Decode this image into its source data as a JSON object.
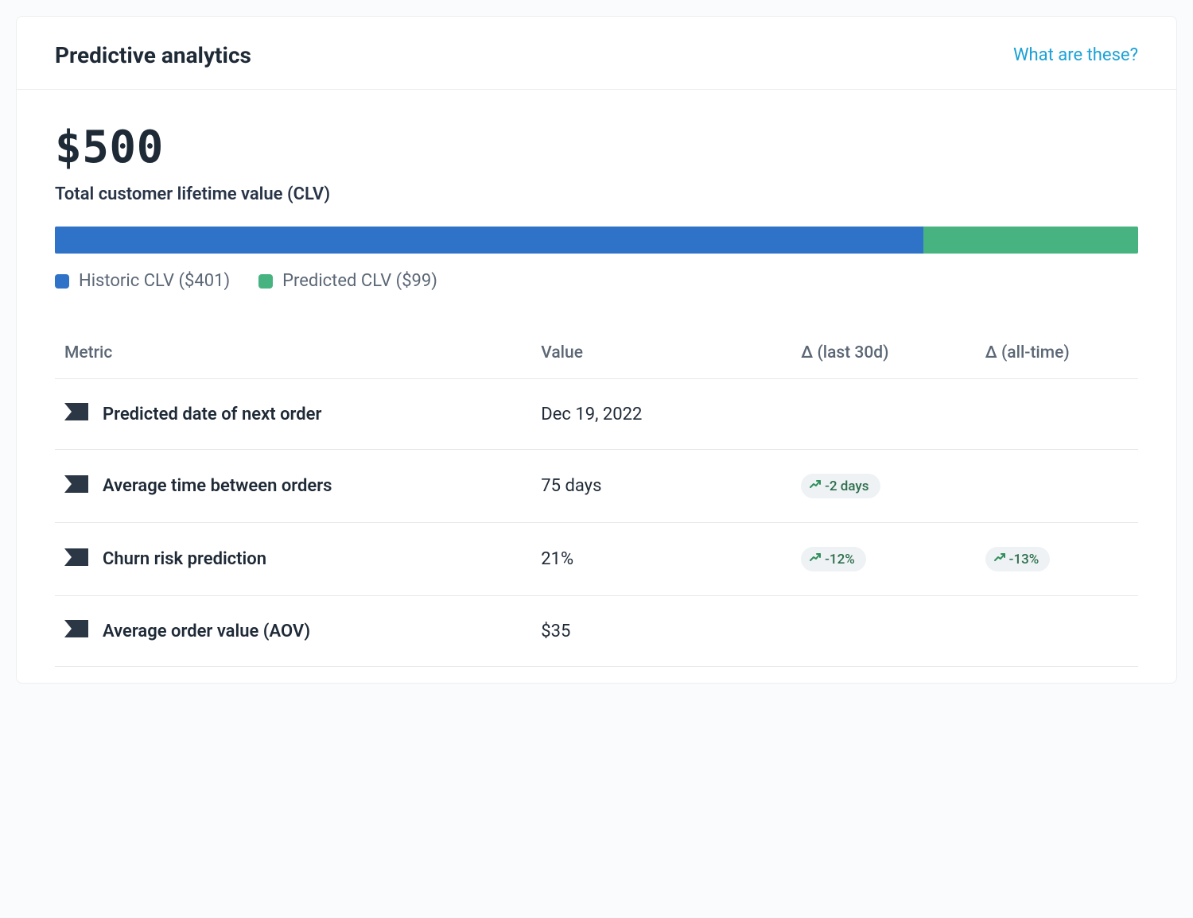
{
  "colors": {
    "historic": "#2e73c8",
    "predicted": "#46b381"
  },
  "header": {
    "title": "Predictive analytics",
    "help_link": "What are these?"
  },
  "clv": {
    "total_display": "$500",
    "total_label": "Total customer lifetime value (CLV)",
    "historic_value": 401,
    "predicted_value": 99,
    "legend": {
      "historic": "Historic CLV ($401)",
      "predicted": "Predicted CLV ($99)"
    }
  },
  "table": {
    "headers": {
      "metric": "Metric",
      "value": "Value",
      "d30": "Δ (last 30d)",
      "dall": "Δ (all-time)"
    },
    "rows": [
      {
        "icon": "tag-icon",
        "label": "Predicted date of next order",
        "value": "Dec 19, 2022",
        "d30": "",
        "dall": ""
      },
      {
        "icon": "tag-icon",
        "label": "Average time between orders",
        "value": "75 days",
        "d30": "-2 days",
        "dall": ""
      },
      {
        "icon": "tag-icon",
        "label": "Churn risk prediction",
        "value": "21%",
        "d30": "-12%",
        "dall": "-13%"
      },
      {
        "icon": "tag-icon",
        "label": "Average order value (AOV)",
        "value": "$35",
        "d30": "",
        "dall": ""
      }
    ]
  },
  "chart_data": {
    "type": "bar",
    "orientation": "horizontal-stacked",
    "title": "Total customer lifetime value (CLV)",
    "series": [
      {
        "name": "Historic CLV",
        "values": [
          401
        ],
        "color": "#2e73c8"
      },
      {
        "name": "Predicted CLV",
        "values": [
          99
        ],
        "color": "#46b381"
      }
    ],
    "total": 500,
    "xlim": [
      0,
      500
    ],
    "unit": "$"
  }
}
